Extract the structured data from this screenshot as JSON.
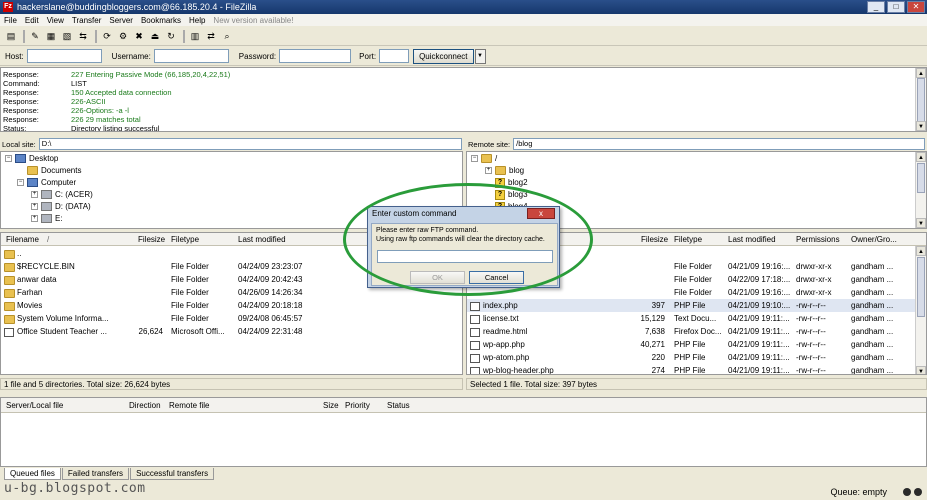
{
  "window": {
    "title": "hackerslane@buddingbloggers.com@66.185.20.4 - FileZilla",
    "app_icon": "Fz"
  },
  "menu": [
    "File",
    "Edit",
    "View",
    "Transfer",
    "Server",
    "Bookmarks",
    "Help"
  ],
  "menu_notice": "New version available!",
  "quickconnect": {
    "host_label": "Host:",
    "username_label": "Username:",
    "password_label": "Password:",
    "port_label": "Port:",
    "button_label": "Quickconnect",
    "dropdown": "▼",
    "host_value": "",
    "username_value": "",
    "password_value": "",
    "port_value": ""
  },
  "log": [
    {
      "k": "Response:",
      "v": "227 Entering Passive Mode (66,185,20,4,22,51)",
      "color": "green"
    },
    {
      "k": "Command:",
      "v": "LIST",
      "color": "black"
    },
    {
      "k": "Response:",
      "v": "150 Accepted data connection",
      "color": "green"
    },
    {
      "k": "Response:",
      "v": "226-ASCII",
      "color": "green"
    },
    {
      "k": "Response:",
      "v": "226-Options: -a -l",
      "color": "green"
    },
    {
      "k": "Response:",
      "v": "226 29 matches total",
      "color": "green"
    },
    {
      "k": "Status:",
      "v": "Directory listing successful",
      "color": "black"
    }
  ],
  "local": {
    "site_label": "Local site:",
    "site_value": "D:\\",
    "tree": [
      {
        "label": "Desktop",
        "icon": "desktop",
        "pm": "−"
      },
      {
        "label": "Documents",
        "icon": "folder",
        "pm": ""
      },
      {
        "label": "Computer",
        "icon": "computer",
        "pm": "−"
      },
      {
        "label": "C: (ACER)",
        "icon": "drive",
        "pm": "+"
      },
      {
        "label": "D: (DATA)",
        "icon": "drive",
        "pm": "+"
      },
      {
        "label": "E:",
        "icon": "drive",
        "pm": "+"
      }
    ],
    "columns": [
      "Filename",
      "/",
      "Filesize",
      "Filetype",
      "Last modified"
    ],
    "files": [
      {
        "name": "..",
        "size": "",
        "type": "",
        "modified": "",
        "icon": "folder"
      },
      {
        "name": "$RECYCLE.BIN",
        "size": "",
        "type": "File Folder",
        "modified": "04/24/09 23:23:07",
        "icon": "folder"
      },
      {
        "name": "anwar data",
        "size": "",
        "type": "File Folder",
        "modified": "04/24/09 20:42:43",
        "icon": "folder"
      },
      {
        "name": "Farhan",
        "size": "",
        "type": "File Folder",
        "modified": "04/26/09 14:26:34",
        "icon": "folder"
      },
      {
        "name": "Movies",
        "size": "",
        "type": "File Folder",
        "modified": "04/24/09 20:18:18",
        "icon": "folder"
      },
      {
        "name": "System Volume Informa...",
        "size": "",
        "type": "File Folder",
        "modified": "09/24/08 06:45:57",
        "icon": "folder"
      },
      {
        "name": "Office Student Teacher ...",
        "size": "26,624",
        "type": "Microsoft Offi...",
        "modified": "04/24/09 22:31:48",
        "icon": "doc"
      }
    ],
    "status": "1 file and 5 directories. Total size: 26,624 bytes"
  },
  "remote": {
    "site_label": "Remote site:",
    "site_value": "/blog",
    "tree": [
      {
        "label": "/",
        "icon": "folder",
        "pm": "−"
      },
      {
        "label": "blog",
        "icon": "folder",
        "pm": "+"
      },
      {
        "label": "blog2",
        "icon": "q",
        "pm": ""
      },
      {
        "label": "blog3",
        "icon": "q",
        "pm": ""
      },
      {
        "label": "blog4",
        "icon": "q",
        "pm": ""
      }
    ],
    "columns": [
      "Filesize",
      "Filetype",
      "Last modified",
      "Permissions",
      "Owner/Gro..."
    ],
    "files": [
      {
        "name": "",
        "size": "",
        "type": "",
        "modified": "",
        "perm": "",
        "owner": "",
        "icon": "none"
      },
      {
        "name": "",
        "size": "",
        "type": "File Folder",
        "modified": "04/21/09 19:16:...",
        "perm": "drwxr-xr-x",
        "owner": "gandham ...",
        "icon": "none"
      },
      {
        "name": "",
        "size": "",
        "type": "File Folder",
        "modified": "04/22/09 17:18:...",
        "perm": "drwxr-xr-x",
        "owner": "gandham ...",
        "icon": "none"
      },
      {
        "name": "",
        "size": "",
        "type": "File Folder",
        "modified": "04/21/09 19:16:...",
        "perm": "drwxr-xr-x",
        "owner": "gandham ...",
        "icon": "none"
      },
      {
        "name": "index.php",
        "size": "397",
        "type": "PHP File",
        "modified": "04/21/09 19:10:...",
        "perm": "-rw-r--r--",
        "owner": "gandham ...",
        "icon": "doc"
      },
      {
        "name": "license.txt",
        "size": "15,129",
        "type": "Text Docu...",
        "modified": "04/21/09 19:11:...",
        "perm": "-rw-r--r--",
        "owner": "gandham ...",
        "icon": "doc"
      },
      {
        "name": "readme.html",
        "size": "7,638",
        "type": "Firefox Doc...",
        "modified": "04/21/09 19:11:...",
        "perm": "-rw-r--r--",
        "owner": "gandham ...",
        "icon": "doc"
      },
      {
        "name": "wp-app.php",
        "size": "40,271",
        "type": "PHP File",
        "modified": "04/21/09 19:11:...",
        "perm": "-rw-r--r--",
        "owner": "gandham ...",
        "icon": "doc"
      },
      {
        "name": "wp-atom.php",
        "size": "220",
        "type": "PHP File",
        "modified": "04/21/09 19:11:...",
        "perm": "-rw-r--r--",
        "owner": "gandham ...",
        "icon": "doc"
      },
      {
        "name": "wp-blog-header.php",
        "size": "274",
        "type": "PHP File",
        "modified": "04/21/09 19:11:...",
        "perm": "-rw-r--r--",
        "owner": "gandham ...",
        "icon": "doc"
      }
    ],
    "status": "Selected 1 file. Total size: 397 bytes"
  },
  "queue": {
    "columns": [
      "Server/Local file",
      "Direction",
      "Remote file",
      "Size",
      "Priority",
      "Status"
    ],
    "tabs": [
      "Queued files",
      "Failed transfers",
      "Successful transfers"
    ],
    "status": "Queue: empty"
  },
  "dialog": {
    "title": "Enter custom command",
    "close": "x",
    "line1": "Please enter raw FTP command.",
    "line2": "Using raw ftp commands will clear the directory cache.",
    "input_value": "",
    "ok": "OK",
    "cancel": "Cancel"
  },
  "watermark": "u-bg.blogspot.com",
  "colors": {
    "highlight": "#2a9c3a",
    "log_green": "#1a7a1a"
  }
}
